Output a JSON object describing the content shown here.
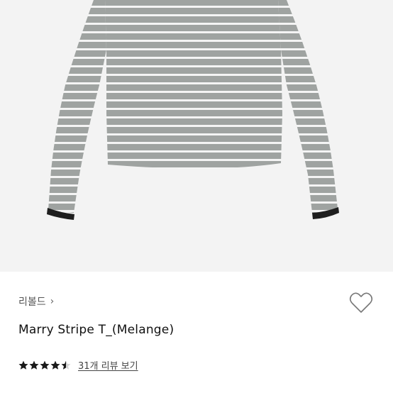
{
  "product": {
    "brand": "리볼드",
    "brand_chevron": "›",
    "title": "Marry Stripe T_(Melange)",
    "rating": 4.5,
    "rating_max": 5,
    "review_link": "31개 리뷰 보기",
    "image_alt": "Gray and white striped long-sleeve top"
  },
  "colors": {
    "stripe_gray": "#9fa3a1",
    "stripe_white": "#f4f4f4",
    "cuff": "#1e1e1e",
    "background": "#f3f3f3",
    "star": "#1a1a1a"
  },
  "icons": {
    "wishlist": "heart-outline-icon",
    "brand_link": "chevron-right-icon",
    "star": "star-icon"
  }
}
